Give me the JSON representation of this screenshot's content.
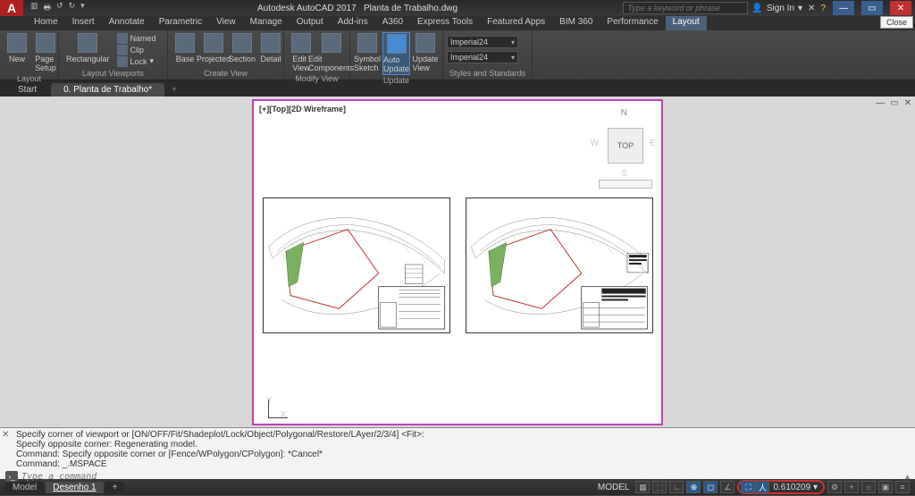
{
  "title": {
    "app": "Autodesk AutoCAD 2017",
    "file": "Planta de Trabalho.dwg"
  },
  "search_placeholder": "Type a keyword or phrase",
  "signin": "Sign In",
  "close_btn_label": "Close",
  "ribbon_tabs": [
    "Home",
    "Insert",
    "Annotate",
    "Parametric",
    "View",
    "Manage",
    "Output",
    "Add-ins",
    "A360",
    "Express Tools",
    "Featured Apps",
    "BIM 360",
    "Performance",
    "Layout"
  ],
  "active_ribbon_tab": 13,
  "panels": {
    "layout": {
      "label": "Layout",
      "items": {
        "new": "New",
        "page_setup": "Page\nSetup"
      }
    },
    "layout_viewports": {
      "label": "Layout Viewports",
      "rectangular": "Rectangular",
      "named": "Named",
      "clip": "Clip",
      "lock": "Lock"
    },
    "create_view": {
      "label": "Create View",
      "items": [
        "Base",
        "Projected",
        "Section",
        "Detail"
      ]
    },
    "modify_view": {
      "label": "Modify View",
      "items": [
        "Edit\nView",
        "Edit\nComponents"
      ]
    },
    "update": {
      "label": "Update",
      "symbol_sketch": "Symbol\nSketch",
      "auto_update": "Auto\nUpdate",
      "update_view": "Update\nView"
    },
    "styles": {
      "label": "Styles and Standards",
      "combo1": "Imperial24",
      "combo2": "Imperial24"
    }
  },
  "file_tabs": {
    "start": "Start",
    "active": "0. Planta de Trabalho*",
    "plus": "+"
  },
  "viewport": {
    "label": "[+][Top][2D Wireframe]",
    "cube": "TOP",
    "n": "N",
    "s": "S",
    "e": "E",
    "w": "W",
    "axis_x": "X",
    "axis_y": "Y"
  },
  "command": {
    "lines": [
      "Specify corner of viewport or [ON/OFF/Fit/Shadeplot/Lock/Object/Polygonal/Restore/LAyer/2/3/4] <Fit>:",
      "Specify opposite corner: Regenerating model.",
      "Command: Specify opposite corner or [Fence/WPolygon/CPolygon]: *Cancel*",
      "Command: _.MSPACE"
    ],
    "placeholder": "Type a command"
  },
  "status": {
    "model_tab": "Model",
    "layout_tab": "Desenho 1",
    "space": "MODEL",
    "scale_value": "0.610209"
  }
}
